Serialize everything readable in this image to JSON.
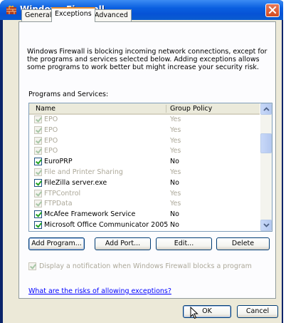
{
  "window": {
    "title": "Windows Firewall"
  },
  "tabs": [
    {
      "label": "General",
      "active": false
    },
    {
      "label": "Exceptions",
      "active": true
    },
    {
      "label": "Advanced",
      "active": false
    }
  ],
  "exceptions": {
    "description": "Windows Firewall is blocking incoming network connections, except for the programs and services selected below. Adding exceptions allows some programs to work better but might increase your security risk.",
    "programs_label": "Programs and Services:",
    "columns": [
      "Name",
      "Group Policy"
    ],
    "rows": [
      {
        "name": "EPO",
        "group_policy": "Yes",
        "checked": true,
        "disabled": true
      },
      {
        "name": "EPO",
        "group_policy": "Yes",
        "checked": true,
        "disabled": true
      },
      {
        "name": "EPO",
        "group_policy": "Yes",
        "checked": true,
        "disabled": true
      },
      {
        "name": "EPO",
        "group_policy": "Yes",
        "checked": true,
        "disabled": true
      },
      {
        "name": "EuroPRP",
        "group_policy": "No",
        "checked": true,
        "disabled": false
      },
      {
        "name": "File and Printer Sharing",
        "group_policy": "Yes",
        "checked": true,
        "disabled": true
      },
      {
        "name": "FileZilla server.exe",
        "group_policy": "No",
        "checked": true,
        "disabled": false
      },
      {
        "name": "FTPControl",
        "group_policy": "Yes",
        "checked": true,
        "disabled": true
      },
      {
        "name": "FTPData",
        "group_policy": "Yes",
        "checked": true,
        "disabled": true
      },
      {
        "name": "McAfee Framework Service",
        "group_policy": "No",
        "checked": true,
        "disabled": false
      },
      {
        "name": "Microsoft Office Communicator 2005",
        "group_policy": "No",
        "checked": true,
        "disabled": false
      }
    ],
    "buttons": {
      "add_program": "Add Program...",
      "add_port": "Add Port...",
      "edit": "Edit...",
      "delete": "Delete"
    },
    "notify_label": "Display a notification when Windows Firewall blocks a program",
    "notify_checked": true,
    "risk_link": "What are the risks of allowing exceptions?"
  },
  "footer": {
    "ok": "OK",
    "cancel": "Cancel"
  },
  "colors": {
    "titlebar": "#0653d6",
    "face": "#ece9d8",
    "link": "#0000ff",
    "close": "#d34b1f"
  }
}
